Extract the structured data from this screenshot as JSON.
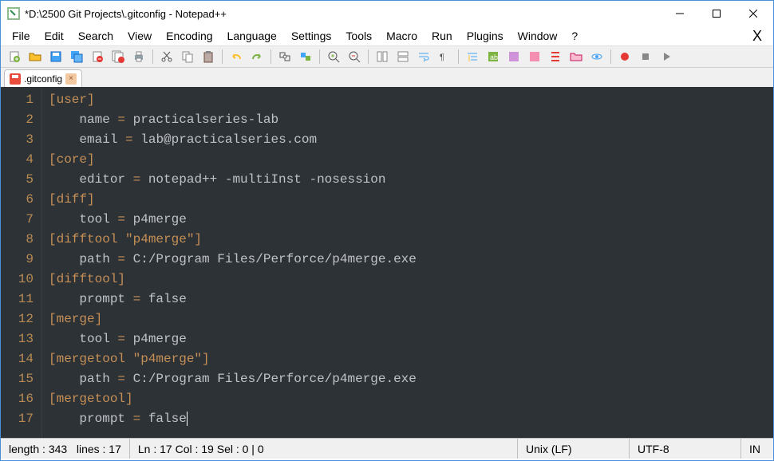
{
  "title": "*D:\\2500 Git Projects\\.gitconfig - Notepad++",
  "menu": [
    "File",
    "Edit",
    "Search",
    "View",
    "Encoding",
    "Language",
    "Settings",
    "Tools",
    "Macro",
    "Run",
    "Plugins",
    "Window",
    "?"
  ],
  "tab": {
    "label": ".gitconfig"
  },
  "lineNumbers": [
    "1",
    "2",
    "3",
    "4",
    "5",
    "6",
    "7",
    "8",
    "9",
    "10",
    "11",
    "12",
    "13",
    "14",
    "15",
    "16",
    "17"
  ],
  "lines": {
    "l1": "[user]",
    "l2_k": "name",
    "l2_v": "practicalseries-lab",
    "l3_k": "email",
    "l3_v": "lab@practicalseries.com",
    "l4": "[core]",
    "l5_k": "editor",
    "l5_v": "notepad++ -multiInst -nosession",
    "l6": "[diff]",
    "l7_k": "tool",
    "l7_v": "p4merge",
    "l8": "[difftool \"p4merge\"]",
    "l9_k": "path",
    "l9_v": "C:/Program Files/Perforce/p4merge.exe",
    "l10": "[difftool]",
    "l11_k": "prompt",
    "l11_v": "false",
    "l12": "[merge]",
    "l13_k": "tool",
    "l13_v": "p4merge",
    "l14": "[mergetool \"p4merge\"]",
    "l15_k": "path",
    "l15_v": "C:/Program Files/Perforce/p4merge.exe",
    "l16": "[mergetool]",
    "l17_k": "prompt",
    "l17_v": "false"
  },
  "status": {
    "length": "length : 343",
    "lines": "lines : 17",
    "pos": "Ln : 17    Col : 19    Sel : 0 | 0",
    "eol": "Unix (LF)",
    "enc": "UTF-8",
    "mode": "IN"
  },
  "eq": " = ",
  "indent": "    "
}
